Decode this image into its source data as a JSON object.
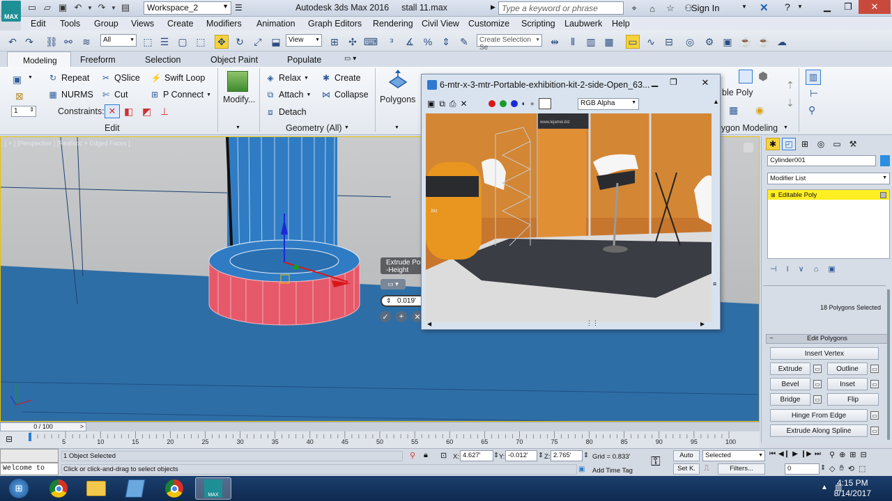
{
  "app": {
    "title": "Autodesk 3ds Max 2016",
    "file": "stall 11.max",
    "logo_text": "MAX",
    "workspace": "Workspace_2",
    "search_placeholder": "Type a keyword or phrase",
    "sign_in": "Sign In"
  },
  "menu": [
    "Edit",
    "Tools",
    "Group",
    "Views",
    "Create",
    "Modifiers",
    "Animation",
    "Graph Editors",
    "Rendering",
    "Civil View",
    "Customize",
    "Scripting",
    "Laubwerk",
    "Help"
  ],
  "toolbar": {
    "filter_select": "All",
    "ref_coord": "View",
    "selection_set": "Create Selection Se"
  },
  "ribbon_tabs": [
    "Modeling",
    "Freeform",
    "Selection",
    "Object Paint",
    "Populate"
  ],
  "ribbon": {
    "edit": {
      "repeat": "Repeat",
      "qslice": "QSlice",
      "swift_loop": "Swift Loop",
      "nurms": "NURMS",
      "cut": "Cut",
      "p_connect": "P Connect",
      "constraints": "Constraints:",
      "spinner_value": "1",
      "panel_label": "Edit"
    },
    "modify": "Modify...",
    "geometry": {
      "relax": "Relax",
      "create": "Create",
      "attach": "Attach",
      "collapse": "Collapse",
      "detach": "Detach",
      "panel_label": "Geometry (All)"
    },
    "polygons": "Polygons",
    "partial_labels": {
      "editable_poly": "ble Poly",
      "polygon_modeling": "lygon Modeling"
    }
  },
  "viewport": {
    "label": "[ + ] [Perspective ] [Realistic + Edged Faces ]",
    "caddy": {
      "title_line1": "Extrude Polygons",
      "title_line2": "-Height",
      "value": "0.019'"
    }
  },
  "render_window": {
    "title": "6-mtr-x-3-mtr-Portable-exhibition-kit-2-side-Open_63...",
    "channel": "RGB Alpha",
    "channel_colors": [
      "#d81818",
      "#1a9a2a",
      "#1a2ad8"
    ],
    "screen_text": "www.lejamei.biz",
    "counter_text": ".biz"
  },
  "command_panel": {
    "object_name": "Cylinder001",
    "object_color": "#2b8ee0",
    "modifier_list": "Modifier List",
    "stack_item": "Editable Poly",
    "selection_info": "18 Polygons Selected",
    "rollout_title": "Edit Polygons",
    "insert_vertex": "Insert Vertex",
    "extrude": "Extrude",
    "outline": "Outline",
    "bevel": "Bevel",
    "inset": "Inset",
    "bridge": "Bridge",
    "flip": "Flip",
    "hinge_from_edge": "Hinge From Edge",
    "extrude_along_spline": "Extrude Along Spline"
  },
  "timeline": {
    "frame_display": "0 / 100",
    "ticks": [
      "0",
      "5",
      "10",
      "15",
      "20",
      "25",
      "30",
      "35",
      "40",
      "45",
      "50",
      "55",
      "60",
      "65",
      "70",
      "75",
      "80",
      "85",
      "90",
      "95",
      "100"
    ]
  },
  "status": {
    "script_listener": "Welcome to",
    "selection": "1 Object Selected",
    "prompt": "Click or click-and-drag to select objects",
    "x_label": "X:",
    "x": "4.627'",
    "y_label": "Y:",
    "y": "-0.012'",
    "z_label": "Z:",
    "z": "2.765'",
    "grid": "Grid = 0.833'",
    "add_time_tag": "Add Time Tag",
    "auto": "Auto",
    "set_k": "Set K.",
    "selected": "Selected",
    "filters": "Filters...",
    "frame": "0"
  },
  "taskbar": {
    "time": "4:15 PM",
    "date": "8/14/2017"
  }
}
